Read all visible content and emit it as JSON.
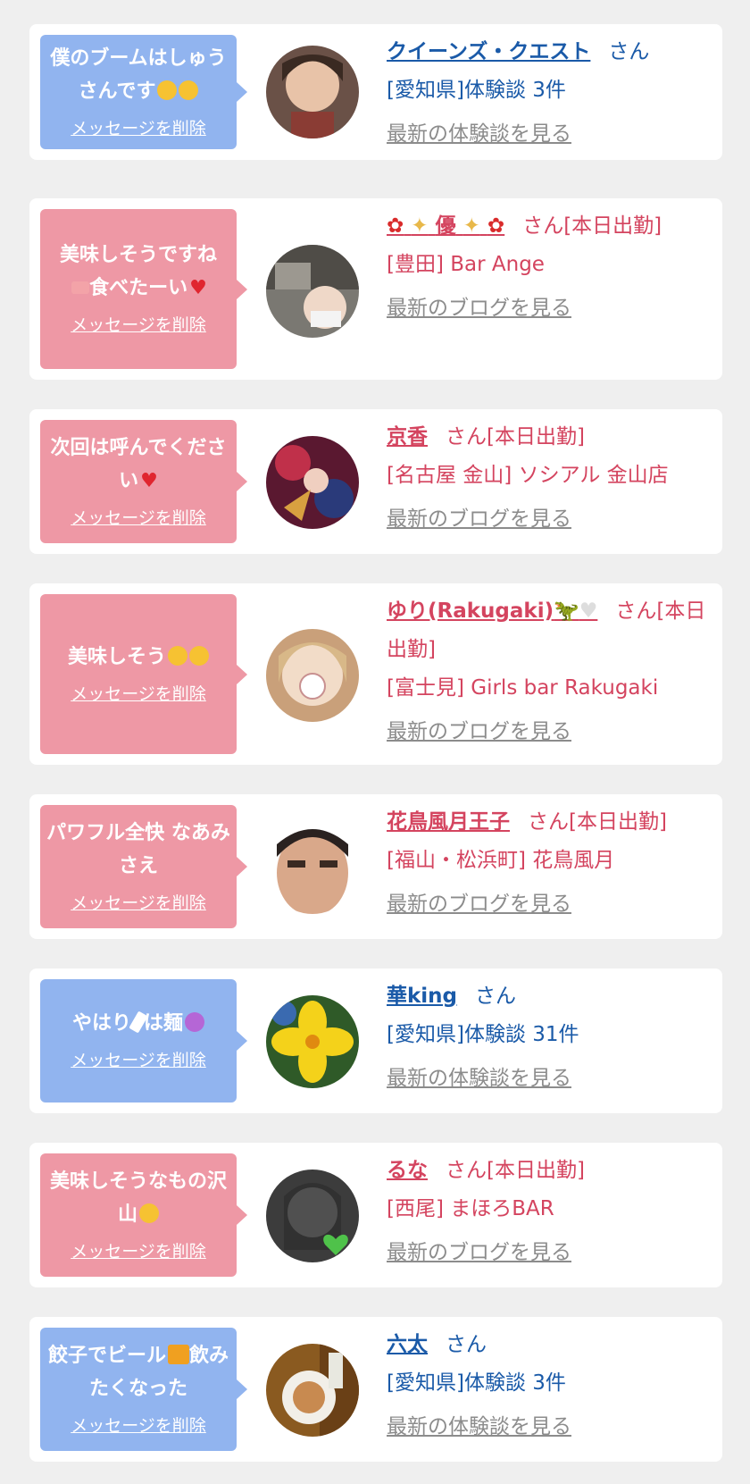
{
  "items": [
    {
      "type": "user",
      "bubble_color": "#91b4ef",
      "message": "僕のブームはしゅうさんです",
      "message_icons": [
        "rolling-laughing-emoji",
        "rolling-laughing-emoji"
      ],
      "delete_label": "メッセージを削除",
      "name": "クイーンズ・クエスト",
      "san": "さん",
      "sub": "[愛知県]体験談 3件",
      "latest_label": "最新の体験談を見る"
    },
    {
      "type": "girl",
      "bubble_color": "#ee98a5",
      "message_a": "美味しそうですね",
      "message_b": "食べたーい",
      "message_icons": [
        "cake-emoji",
        "heart-emoji"
      ],
      "delete_label": "メッセージを削除",
      "name": "優",
      "name_icons": [
        "hibiscus-emoji",
        "sparkles-emoji",
        "sparkles-emoji",
        "hibiscus-emoji"
      ],
      "san": "さん[本日出勤]",
      "sub": "[豊田] Bar Ange",
      "latest_label": "最新のブログを見る"
    },
    {
      "type": "girl",
      "bubble_color": "#ee98a5",
      "message": "次回は呼んでください",
      "message_icons": [
        "heart-emoji"
      ],
      "delete_label": "メッセージを削除",
      "name": "京香",
      "san": "さん[本日出勤]",
      "sub": "[名古屋 金山] ソシアル 金山店",
      "latest_label": "最新のブログを見る"
    },
    {
      "type": "girl",
      "bubble_color": "#ee98a5",
      "message": "美味しそう",
      "message_icons": [
        "drooling-emoji",
        "drooling-emoji"
      ],
      "delete_label": "メッセージを削除",
      "name": "ゆり(Rakugaki)",
      "name_icons": [
        "dinosaur-emoji",
        "white-heart-emoji"
      ],
      "san": "さん[本日出勤]",
      "sub": "[富士見] Girls bar Rakugaki",
      "latest_label": "最新のブログを見る"
    },
    {
      "type": "girl",
      "bubble_color": "#ee98a5",
      "message": "パワフル全快 なあみさえ",
      "delete_label": "メッセージを削除",
      "name": "花鳥風月王子",
      "san": "さん[本日出勤]",
      "sub": "[福山・松浜町] 花鳥風月",
      "latest_label": "最新のブログを見る"
    },
    {
      "type": "user",
      "bubble_color": "#91b4ef",
      "message_a": "やはり",
      "message_b": "は麺",
      "message_icons": [
        "chopsticks-emoji",
        "smiling-devil-emoji"
      ],
      "delete_label": "メッセージを削除",
      "name": "華king",
      "san": "さん",
      "sub": "[愛知県]体験談 31件",
      "latest_label": "最新の体験談を見る"
    },
    {
      "type": "girl",
      "bubble_color": "#ee98a5",
      "message": "美味しそうなもの沢山",
      "message_icons": [
        "drooling-emoji"
      ],
      "delete_label": "メッセージを削除",
      "name": "るな",
      "san": "さん[本日出勤]",
      "sub": "[西尾] まほろBAR",
      "latest_label": "最新のブログを見る"
    },
    {
      "type": "user",
      "bubble_color": "#91b4ef",
      "message_a": "餃子でビール",
      "message_b": "飲みたくなった",
      "message_icons": [
        "beer-emoji"
      ],
      "delete_label": "メッセージを削除",
      "name": "六太",
      "san": "さん",
      "sub": "[愛知県]体験談 3件",
      "latest_label": "最新の体験談を見る"
    }
  ]
}
